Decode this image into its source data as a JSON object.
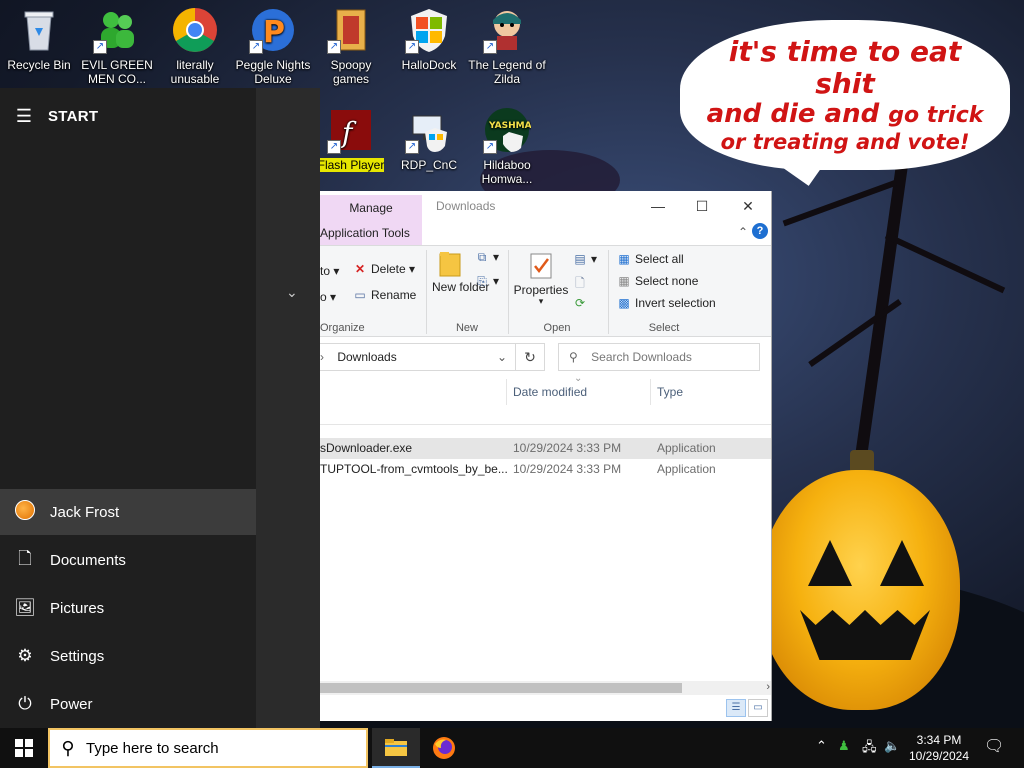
{
  "desktop": {
    "icons": [
      {
        "label": "Recycle Bin",
        "icon": "recycle-bin-icon"
      },
      {
        "label": "EVIL GREEN MEN CO...",
        "icon": "green-men-icon"
      },
      {
        "label": "literally unusable",
        "icon": "chrome-icon"
      },
      {
        "label": "Peggle Nights Deluxe",
        "icon": "peggle-icon"
      },
      {
        "label": "Spoopy games",
        "icon": "folder-icon"
      },
      {
        "label": "HalloDock",
        "icon": "windows-shield-icon"
      },
      {
        "label": "The Legend of Zilda",
        "icon": "zelda-character-icon"
      },
      {
        "label": "Flash Player",
        "icon": "flash-icon"
      },
      {
        "label": "RDP_CnC",
        "icon": "rdp-icon"
      },
      {
        "label": "Hildaboo Homwa...",
        "icon": "yashma-icon"
      }
    ],
    "speech": {
      "line1": "it's time to eat shit",
      "line2a": "and die and",
      "line2b": "go trick",
      "line3": "or treating and vote!"
    }
  },
  "start_menu": {
    "title": "START",
    "user": "Jack Frost",
    "items": [
      {
        "label": "Documents",
        "icon": "document-icon"
      },
      {
        "label": "Pictures",
        "icon": "pictures-icon"
      },
      {
        "label": "Settings",
        "icon": "gear-icon"
      },
      {
        "label": "Power",
        "icon": "power-icon"
      }
    ]
  },
  "explorer": {
    "context_tab": "Manage",
    "window_title": "Downloads",
    "context_group": "Application Tools",
    "ribbon": {
      "move_to": "to",
      "copy_to": "o",
      "delete": "Delete",
      "rename": "Rename",
      "new_folder": "New folder",
      "properties": "Properties",
      "select_all": "Select all",
      "select_none": "Select none",
      "invert_selection": "Invert selection",
      "groups": {
        "organize": "Organize",
        "new": "New",
        "open": "Open",
        "select": "Select"
      }
    },
    "address": {
      "path": "Downloads",
      "search_placeholder": "Search Downloads"
    },
    "columns": {
      "date": "Date modified",
      "type": "Type"
    },
    "files": [
      {
        "name": "sDownloader.exe",
        "date": "10/29/2024 3:33 PM",
        "type": "Application"
      },
      {
        "name": "TUPTOOL-from_cvmtools_by_be...",
        "date": "10/29/2024 3:33 PM",
        "type": "Application"
      }
    ]
  },
  "taskbar": {
    "search_placeholder": "Type here to search",
    "time": "3:34 PM",
    "date": "10/29/2024"
  }
}
